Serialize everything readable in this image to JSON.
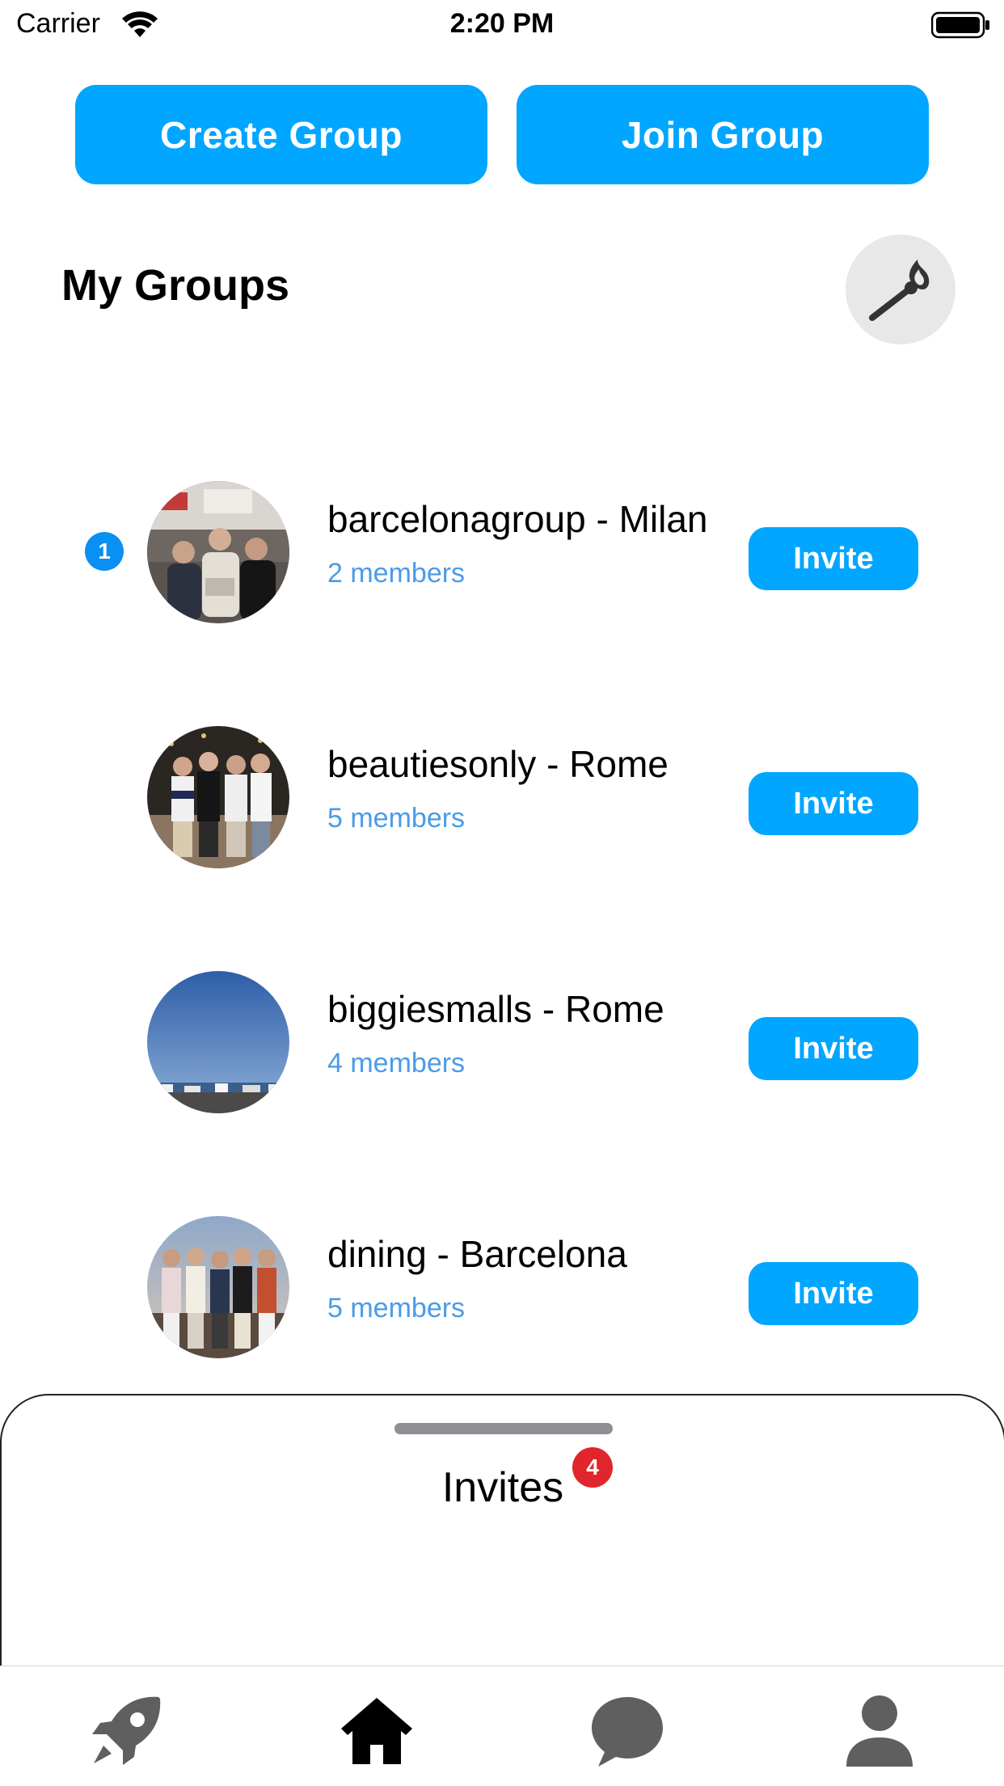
{
  "status_bar": {
    "carrier": "Carrier",
    "time": "2:20 PM"
  },
  "actions": {
    "create_group": "Create Group",
    "join_group": "Join Group"
  },
  "groups_section": {
    "title": "My Groups",
    "match_icon": "match-flame-icon"
  },
  "groups": [
    {
      "name": "barcelonagroup - Milan",
      "members": "2 members",
      "unread": "1",
      "invite_label": "Invite"
    },
    {
      "name": "beautiesonly - Rome",
      "members": "5 members",
      "invite_label": "Invite"
    },
    {
      "name": "biggiesmalls - Rome",
      "members": "4 members",
      "invite_label": "Invite"
    },
    {
      "name": "dining - Barcelona",
      "members": "5 members",
      "invite_label": "Invite"
    }
  ],
  "invites": {
    "title": "Invites",
    "count": "4"
  },
  "tab_bar": {
    "tabs": [
      {
        "icon": "rocket-icon"
      },
      {
        "icon": "home-icon",
        "selected": true
      },
      {
        "icon": "chat-bubble-icon"
      },
      {
        "icon": "person-icon"
      }
    ]
  },
  "colors": {
    "accent": "#00a6ff",
    "members_text": "#4a9be8",
    "badge_red": "#e0262c",
    "unread_blue": "#0a8ff2"
  }
}
